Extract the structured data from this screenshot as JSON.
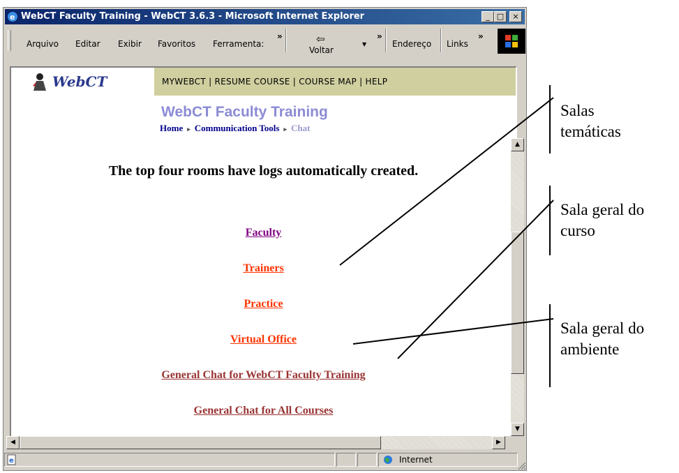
{
  "window": {
    "title": "WebCT Faculty Training - WebCT 3.6.3 - Microsoft Internet Explorer",
    "minimize": "_",
    "maximize": "□",
    "close": "×"
  },
  "menu": [
    "Arquivo",
    "Editar",
    "Exibir",
    "Favoritos",
    "Ferramenta:"
  ],
  "toolbar": {
    "back_label": "Voltar",
    "back_arrow": "⇦",
    "address_label": "Endereço",
    "links_label": "Links",
    "chevron": "»",
    "dropdown": "▼"
  },
  "webct": {
    "logo_text": "WebCT",
    "nav": "MYWEBCT  |  RESUME COURSE  |  COURSE MAP  |  HELP",
    "site_title": "WebCT Faculty Training",
    "breadcrumb": [
      "Home",
      "Communication Tools",
      "Chat"
    ],
    "breadcrumb_sep": "▸"
  },
  "heading": "The top four rooms have logs automatically created.",
  "rooms": [
    {
      "label": "Faculty",
      "color": "#800080"
    },
    {
      "label": "Trainers",
      "color": "#ff3300"
    },
    {
      "label": "Practice",
      "color": "#ff3300"
    },
    {
      "label": "Virtual Office",
      "color": "#ff3300"
    },
    {
      "label": "General Chat for WebCT Faculty Training",
      "color": "#993333"
    },
    {
      "label": "General Chat for All Courses",
      "color": "#993333"
    }
  ],
  "status": {
    "zone": "Internet"
  },
  "annotations": [
    {
      "line1": "Salas",
      "line2": "temáticas"
    },
    {
      "line1": "Sala geral do",
      "line2": "curso"
    },
    {
      "line1": "Sala geral do",
      "line2": "ambiente"
    }
  ],
  "scroll": {
    "up": "▲",
    "down": "▼",
    "left": "◀",
    "right": "▶"
  }
}
